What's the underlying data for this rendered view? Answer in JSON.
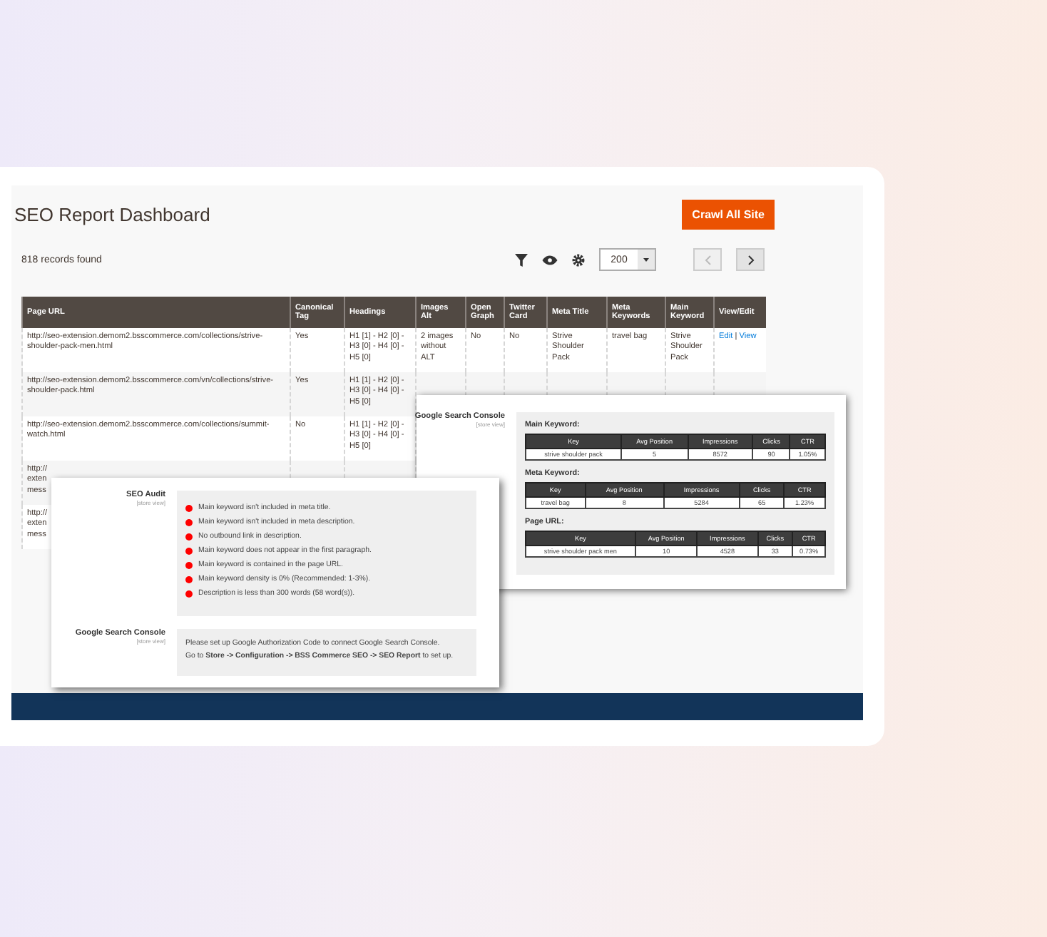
{
  "page": {
    "title": "SEO Report Dashboard",
    "primary_button": "Crawl All Site",
    "records": "818 records found",
    "page_size": "200"
  },
  "table": {
    "columns": [
      "Page URL",
      "Canonical Tag",
      "Headings",
      "Images Alt",
      "Open Graph",
      "Twitter Card",
      "Meta Title",
      "Meta Keywords",
      "Main Keyword",
      "View/Edit"
    ],
    "rows": [
      {
        "cells": [
          "http://seo-extension.demom2.bsscommerce.com/collections/strive-shoulder-pack-men.html",
          "Yes",
          "H1 [1] - H2 [0] - H3 [0] - H4 [0] - H5 [0]",
          "2 images without ALT",
          "No",
          "No",
          "Strive Shoulder Pack",
          "travel bag",
          "Strive Shoulder Pack"
        ],
        "links": [
          "Edit",
          "View"
        ],
        "link_separator": "|"
      },
      {
        "cells": [
          "http://seo-extension.demom2.bsscommerce.com/vn/collections/strive-shoulder-pack.html",
          "Yes",
          "H1 [1] - H2 [0] - H3 [0] - H4 [0] - H5 [0]"
        ],
        "links": []
      },
      {
        "cells": [
          "http://seo-extension.demom2.bsscommerce.com/collections/summit-watch.html",
          "No",
          "H1 [1] - H2 [0] - H3 [0] - H4 [0] - H5 [0]"
        ],
        "links": []
      },
      {
        "cells": [
          "http://\nexten\nmess"
        ],
        "links": []
      },
      {
        "cells": [
          "http://\nexten\nmess"
        ],
        "links": []
      }
    ]
  },
  "gsc_panel": {
    "label": "Google Search Console",
    "scope": "[store view]",
    "sections": [
      {
        "title": "Main Keyword:",
        "columns": [
          "Key",
          "Avg Position",
          "Impressions",
          "Clicks",
          "CTR"
        ],
        "row": [
          "strive shoulder pack",
          "5",
          "8572",
          "90",
          "1.05%"
        ]
      },
      {
        "title": "Meta Keyword:",
        "columns": [
          "Key",
          "Avg Position",
          "Impressions",
          "Clicks",
          "CTR"
        ],
        "row": [
          "travel bag",
          "8",
          "5284",
          "65",
          "1.23%"
        ]
      },
      {
        "title": "Page URL:",
        "columns": [
          "Key",
          "Avg Position",
          "Impressions",
          "Clicks",
          "CTR"
        ],
        "row": [
          "strive shoulder pack men",
          "10",
          "4528",
          "33",
          "0.73%"
        ]
      }
    ]
  },
  "audit_panel": {
    "audit_label": "SEO Audit",
    "audit_scope": "[store view]",
    "items": [
      {
        "text": "Main keyword isn't included in meta title.",
        "color": "#ff0000"
      },
      {
        "text": "Main keyword isn't included in meta description.",
        "color": "#ff0000"
      },
      {
        "text": "No outbound link in description.",
        "color": "#ff0000"
      },
      {
        "text": "Main keyword does not appear in the first paragraph.",
        "color": "#ff0000"
      },
      {
        "text": "Main keyword is contained in the page URL.",
        "color": "#ff0000"
      },
      {
        "text": "Main keyword density is 0% (Recommended: 1-3%).",
        "color": "#ff0000"
      },
      {
        "text": "Description is less than 300 words (58 word(s)).",
        "color": "#ff0000"
      }
    ],
    "gsc_label": "Google Search Console",
    "gsc_scope": "[store view]",
    "gsc_message": "Please set up Google Authorization Code to connect Google Search Console.\nGo to **Store -> Configuration -> BSS Commerce SEO -> SEO Report** to set up."
  }
}
